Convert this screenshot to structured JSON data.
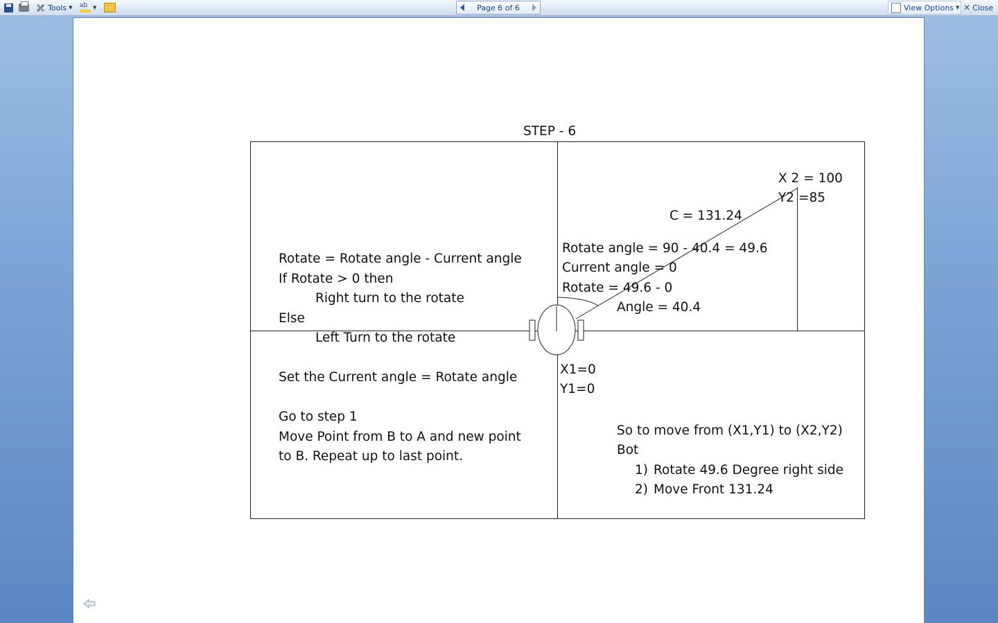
{
  "toolbar": {
    "tools_label": "Tools",
    "spell_label": "ab",
    "pager_label": "Page 6 of 6",
    "view_options_label": "View Options",
    "close_label": "Close"
  },
  "document": {
    "step_title": "STEP - 6",
    "left_panel": {
      "line1": "Rotate = Rotate angle - Current angle",
      "line2": "If Rotate > 0 then",
      "line3": "Right turn to the rotate",
      "line4": "Else",
      "line5": "Left Turn to the rotate",
      "line6": "Set the Current angle = Rotate angle",
      "line7": "Go to step 1",
      "line8": "Move Point from B to A and new point",
      "line9": "to B. Repeat up to last point."
    },
    "right_panel": {
      "x2": "X 2 = 100",
      "y2": "Y2 =85",
      "c": "C = 131.24",
      "rotate_angle": "Rotate angle = 90 - 40.4 = 49.6",
      "current_angle": "Current angle = 0",
      "rotate": "Rotate = 49.6 - 0",
      "angle": "Angle = 40.4",
      "x1": "X1=0",
      "y1": "Y1=0",
      "move_line1": "So to move from (X1,Y1) to (X2,Y2)",
      "move_line2": "Bot",
      "step1_num": "1)",
      "step1_text": "Rotate 49.6 Degree  right side",
      "step2_num": "2)",
      "step2_text": "Move Front 131.24"
    }
  }
}
